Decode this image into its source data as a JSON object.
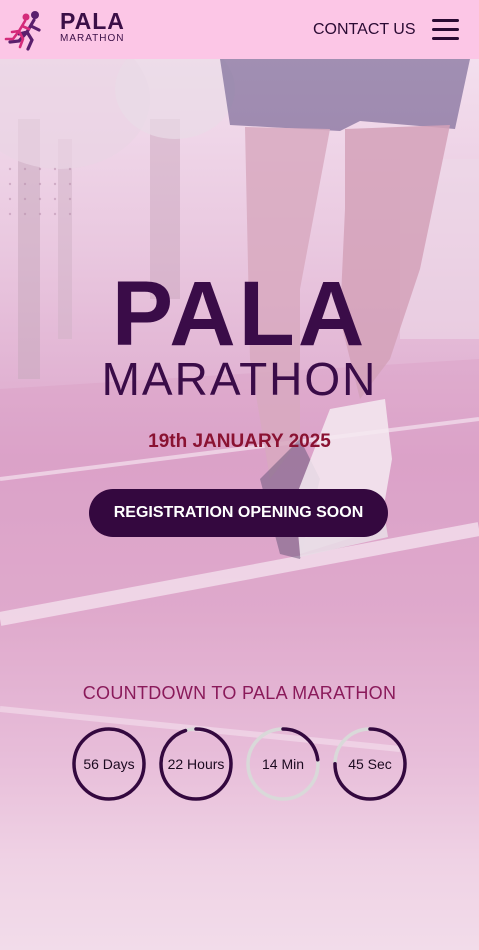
{
  "header": {
    "logo_title": "PALA",
    "logo_subtitle": "MARATHON",
    "contact_label": "CONTACT US"
  },
  "hero": {
    "title": "PALA",
    "subtitle": "MARATHON",
    "date": "19th JANUARY 2025",
    "cta_label": "REGISTRATION OPENING SOON"
  },
  "countdown": {
    "title": "COUNTDOWN TO PALA MARATHON",
    "items": [
      {
        "label": "56 Days",
        "progress": 1.0
      },
      {
        "label": "22 Hours",
        "progress": 0.95
      },
      {
        "label": "14 Min",
        "progress": 0.23
      },
      {
        "label": "45 Sec",
        "progress": 0.75
      }
    ]
  },
  "colors": {
    "header_bg": "#fcc6e6",
    "brand_dark": "#3a0c48",
    "date_red": "#8a1232",
    "ring_track": "#d9d9d9",
    "ring_fill": "#34083f"
  }
}
